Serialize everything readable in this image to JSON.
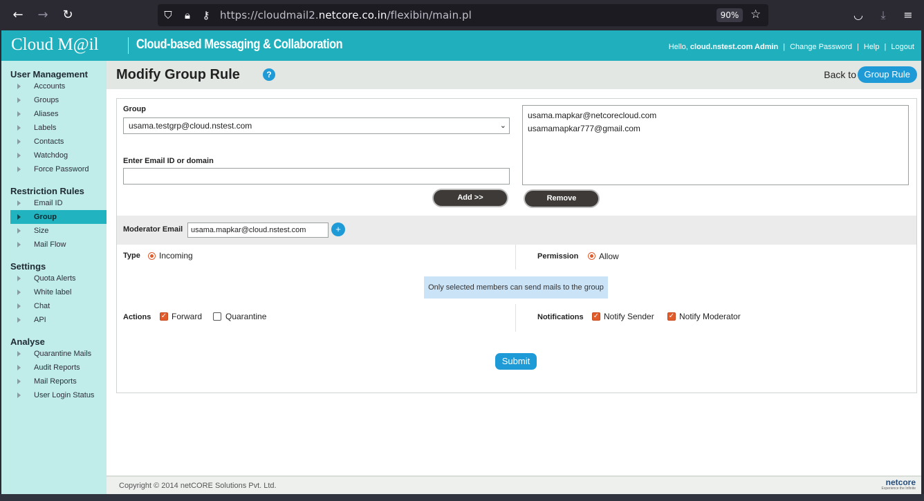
{
  "browser": {
    "url_prefix": "https://cloudmail2.",
    "url_host": "netcore.co.in",
    "url_path": "/flexibin/main.pl",
    "zoom": "90%"
  },
  "header": {
    "logo": "Cloud M@il",
    "tagline": "Cloud-based Messaging & Collaboration",
    "hello_prefix": "Hello, ",
    "user": "cloud.nstest.com Admin",
    "change_password": "Change Password",
    "help": "Help",
    "logout": "Logout"
  },
  "sidebar": {
    "user_management": {
      "title": "User Management",
      "items": [
        "Accounts",
        "Groups",
        "Aliases",
        "Labels",
        "Contacts",
        "Watchdog",
        "Force Password"
      ]
    },
    "restriction_rules": {
      "title": "Restriction Rules",
      "items": [
        "Email ID",
        "Group",
        "Size",
        "Mail Flow"
      ],
      "active": "Group"
    },
    "settings": {
      "title": "Settings",
      "items": [
        "Quota Alerts",
        "White label",
        "Chat",
        "API"
      ]
    },
    "analyse": {
      "title": "Analyse",
      "items": [
        "Quarantine Mails",
        "Audit Reports",
        "Mail Reports",
        "User Login Status"
      ]
    }
  },
  "page": {
    "title": "Modify Group Rule",
    "help_icon": "?",
    "back_to": "Back to",
    "back_button": "Group Rule"
  },
  "form": {
    "group_label": "Group",
    "group_value": "usama.testgrp@cloud.nstest.com",
    "email_label": "Enter Email ID or domain",
    "email_value": "",
    "members": [
      "usama.mapkar@netcorecloud.com",
      "usamamapkar777@gmail.com"
    ],
    "add_button": "Add >>",
    "remove_button": "Remove",
    "moderator_label": "Moderator Email",
    "moderator_value": "usama.mapkar@cloud.nstest.com",
    "plus": "+",
    "type_label": "Type",
    "type_option": "Incoming",
    "permission_label": "Permission",
    "permission_option": "Allow",
    "note": "Only selected members can send mails to the group",
    "actions_label": "Actions",
    "action_forward": "Forward",
    "action_quarantine": "Quarantine",
    "notifications_label": "Notifications",
    "notify_sender": "Notify Sender",
    "notify_moderator": "Notify Moderator",
    "submit": "Submit"
  },
  "footer": {
    "copyright": "Copyright © 2014 netCORE Solutions Pvt. Ltd.",
    "brand": "netcore",
    "brand_tagline": "Experience the Infinite"
  },
  "colors": {
    "header": "#20b0bd",
    "sidebar": "#c0ecea",
    "accent": "#1e9ad6",
    "check": "#e25b2a"
  }
}
